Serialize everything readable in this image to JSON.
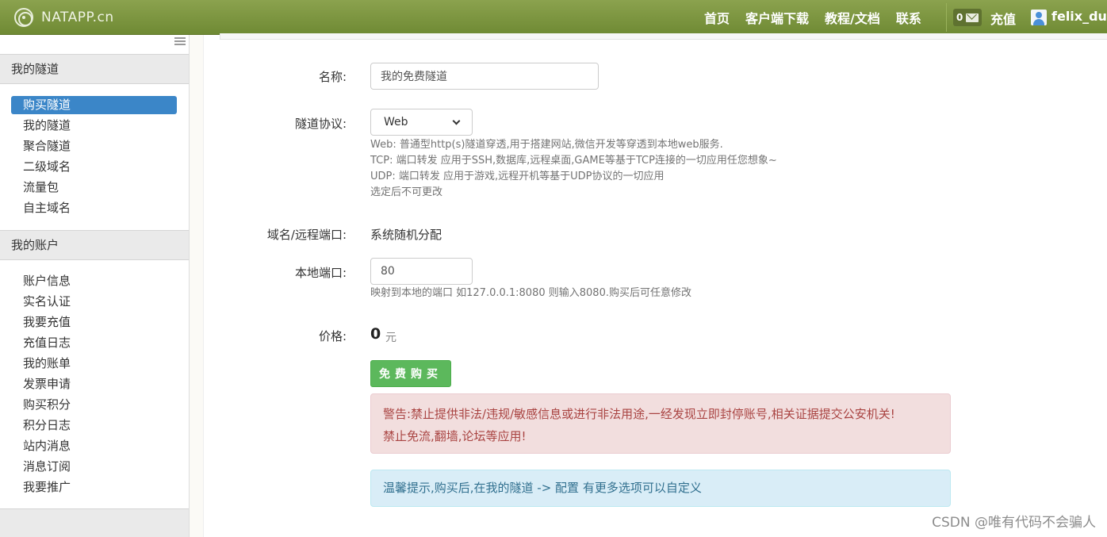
{
  "navbar": {
    "brand": "NATAPP.cn",
    "links": [
      "首页",
      "客户端下载",
      "教程/文档",
      "联系"
    ],
    "message_count": "0",
    "recharge": "充值",
    "username": "felix_du"
  },
  "sidebar": {
    "section1_title": "我的隧道",
    "section1_items": [
      "购买隧道",
      "我的隧道",
      "聚合隧道",
      "二级域名",
      "流量包",
      "自主域名"
    ],
    "section2_title": "我的账户",
    "section2_items": [
      "账户信息",
      "实名认证",
      "我要充值",
      "充值日志",
      "我的账单",
      "发票申请",
      "购买积分",
      "积分日志",
      "站内消息",
      "消息订阅",
      "我要推广"
    ]
  },
  "form": {
    "name_label": "名称:",
    "name_value": "我的免费隧道",
    "protocol_label": "隧道协议:",
    "protocol_value": "Web",
    "protocol_help": [
      "Web: 普通型http(s)隧道穿透,用于搭建网站,微信开发等穿透到本地web服务.",
      "TCP: 端口转发 应用于SSH,数据库,远程桌面,GAME等基于TCP连接的一切应用任您想象~",
      "UDP: 端口转发 应用于游戏,远程开机等基于UDP协议的一切应用",
      "选定后不可更改"
    ],
    "domain_label": "域名/远程端口:",
    "domain_value": "系统随机分配",
    "local_port_label": "本地端口:",
    "local_port_value": "80",
    "local_port_help": "映射到本地的端口 如127.0.0.1:8080 则输入8080.购买后可任意修改",
    "price_label": "价格:",
    "price_value": "0",
    "price_unit": "元",
    "buy_button": "免费购买"
  },
  "alerts": {
    "danger_line1": "警告:禁止提供非法/违规/敏感信息或进行非法用途,一经发现立即封停账号,相关证据提交公安机关!",
    "danger_line2": "禁止免流,翻墙,论坛等应用!",
    "info": "温馨提示,购买后,在我的隧道 -> 配置 有更多选项可以自定义"
  },
  "watermark": "CSDN @唯有代码不会骗人",
  "colors": {
    "navbar": "#7a9440",
    "active_item": "#3b86c8",
    "buy_button": "#5cb85c",
    "danger_bg": "#f2dede",
    "info_bg": "#d9edf7"
  }
}
